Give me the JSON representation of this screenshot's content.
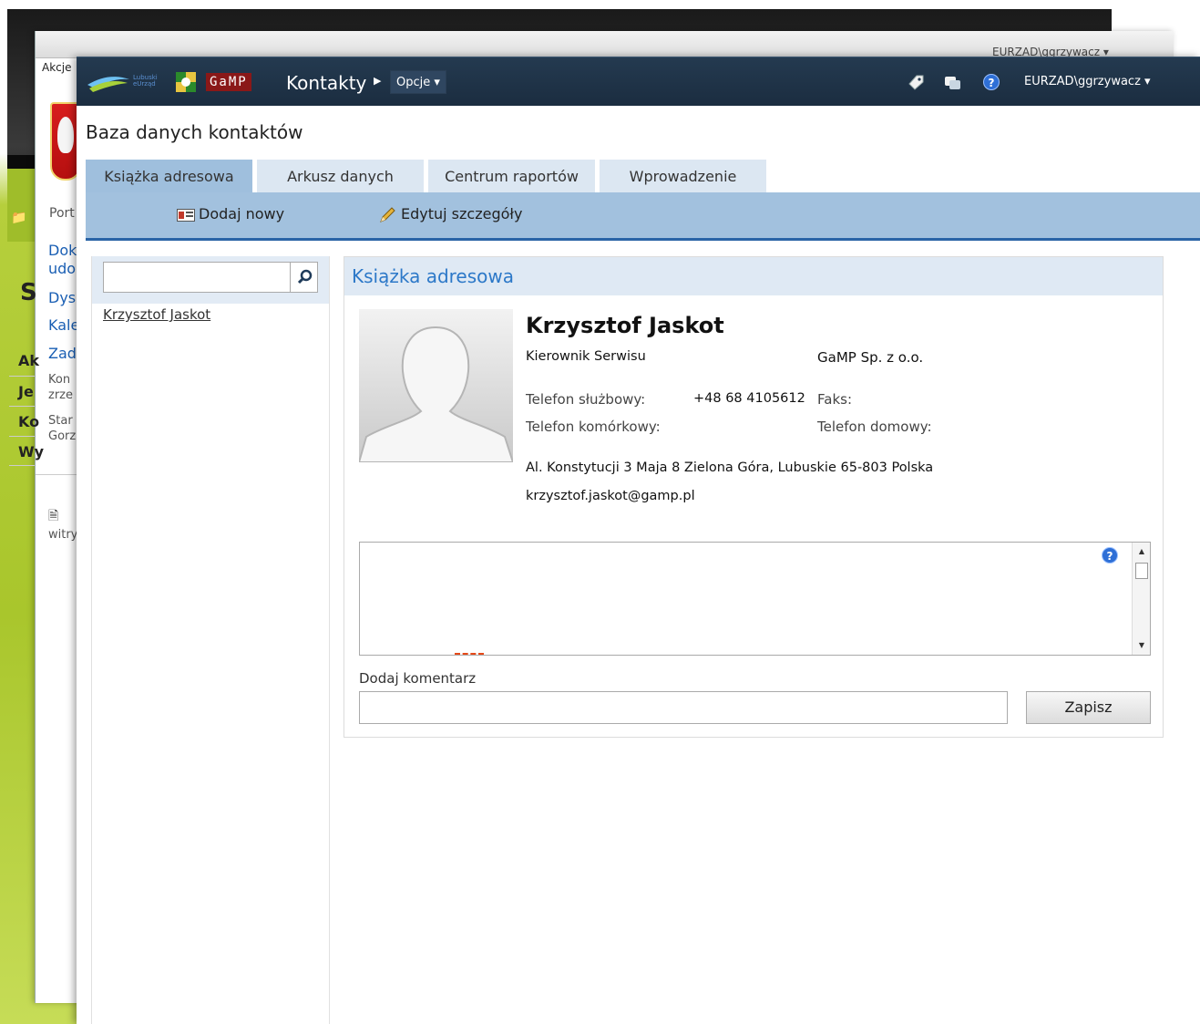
{
  "background_window": {
    "akcje": "Akcje",
    "user": "EURZAD\\ggrzywacz ▾",
    "fragments": [
      "Port",
      "Dok",
      "udo",
      "Dys",
      "Kale",
      "Zad",
      "Kon",
      "zrze",
      "Star",
      "Gorz",
      "witry",
      "S",
      "Ak",
      "Je",
      "Ko",
      "Wy"
    ]
  },
  "header": {
    "logo_text": "Lubuski eUrząd",
    "gamp_logo": "GaMP",
    "app_title": "Kontakty",
    "options_label": "Opcje ▾",
    "user_label": "EURZAD\\ggrzywacz ▾",
    "help_symbol": "?"
  },
  "page": {
    "title": "Baza danych kontaktów"
  },
  "tabs": [
    {
      "label": "Książka adresowa",
      "active": true
    },
    {
      "label": "Arkusz danych",
      "active": false
    },
    {
      "label": "Centrum raportów",
      "active": false
    },
    {
      "label": "Wprowadzenie",
      "active": false
    }
  ],
  "toolbar": {
    "add_new": "Dodaj nowy",
    "edit_details": "Edytuj szczegóły"
  },
  "search": {
    "placeholder": "",
    "value": ""
  },
  "contacts": [
    {
      "name": "Krzysztof Jaskot"
    }
  ],
  "card": {
    "title": "Książka adresowa",
    "name": "Krzysztof Jaskot",
    "job_title": "Kierownik Serwisu",
    "company": "GaMP Sp. z o.o.",
    "work_phone_label": "Telefon służbowy:",
    "work_phone": "+48 68 4105612",
    "fax_label": "Faks:",
    "mobile_label": "Telefon komórkowy:",
    "home_phone_label": "Telefon domowy:",
    "address": "Al. Konstytucji 3 Maja 8 Zielona Góra, Lubuskie 65-803 Polska",
    "email": "krzysztof.jaskot@gamp.pl"
  },
  "comments": {
    "add_label": "Dodaj komentarz",
    "input_value": "",
    "save_label": "Zapisz"
  },
  "colors": {
    "nav_bg": "#1b2d40",
    "tab_active": "#9fbfdd",
    "tab_inactive": "#dce7f2",
    "accent_blue": "#2c78c8",
    "toolbar_bg": "#a2c1de"
  }
}
